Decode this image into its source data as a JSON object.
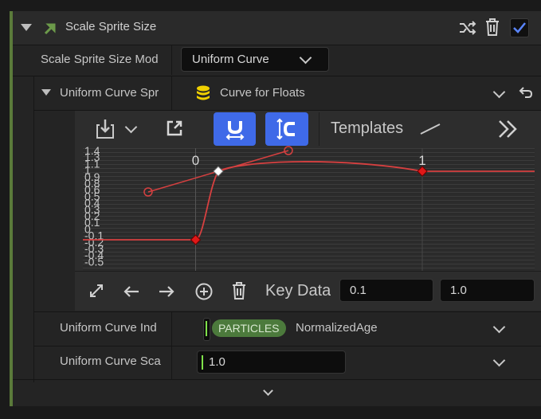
{
  "header": {
    "title": "Scale Sprite Size"
  },
  "mode_row": {
    "label": "Scale Sprite Size Mod",
    "value": "Uniform Curve"
  },
  "curve_row": {
    "label": "Uniform Curve Spr",
    "value": "Curve for Floats"
  },
  "toolbar": {
    "templates_label": "Templates"
  },
  "curve": {
    "x_ticks": [
      "0",
      "1"
    ],
    "y_ticks": [
      "1.4",
      "1.3",
      "1.1",
      "1",
      "0.9",
      "0.8",
      "0.6",
      "0.5",
      "0.4",
      "0.3",
      "0.2",
      "0.1",
      "0",
      "-0.1",
      "-0.2",
      "-0.3",
      "-0.4",
      "-0.5"
    ],
    "keys": [
      {
        "x": 0.0,
        "y": 0.0
      },
      {
        "x": 0.1,
        "y": 1.0,
        "selected": true
      },
      {
        "x": 1.0,
        "y": 1.0
      }
    ]
  },
  "key_data": {
    "label": "Key Data",
    "time": "0.1",
    "value": "1.0"
  },
  "index_row": {
    "label": "Uniform Curve Ind",
    "badge": "PARTICLES",
    "value": "NormalizedAge"
  },
  "scale_row": {
    "label": "Uniform Curve Sca",
    "value": "1.0"
  },
  "colors": {
    "accent_blue": "#3f6ae8",
    "curve_red": "#d64040",
    "badge_green": "#4c7a3c",
    "enabled_green": "#5a7a3a"
  }
}
